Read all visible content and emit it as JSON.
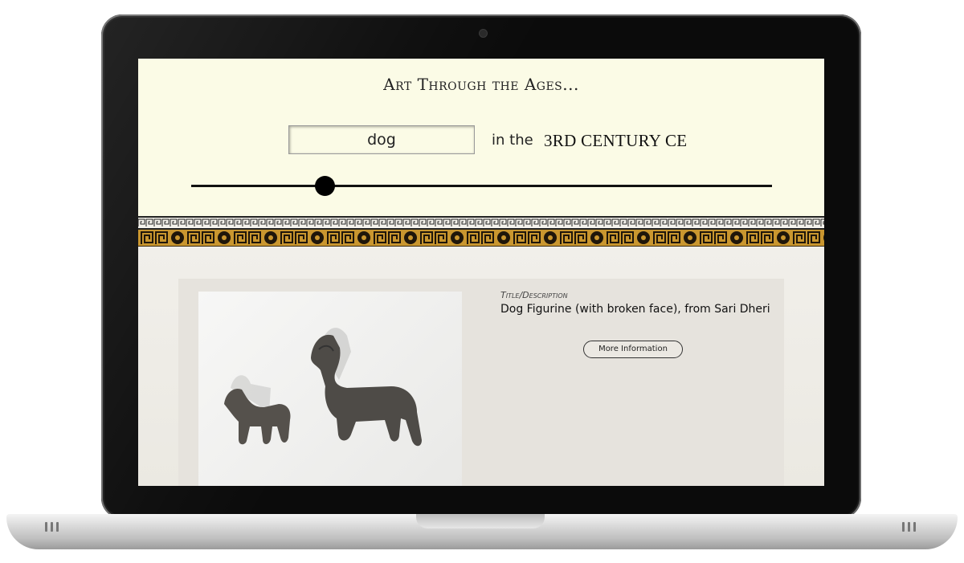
{
  "header": {
    "title": "Art Through the Ages..."
  },
  "search": {
    "value": "dog",
    "connector": "in the",
    "era": "3RD CENTURY CE"
  },
  "timeline": {
    "position_fraction": 0.23
  },
  "result": {
    "description_label": "Title/Description",
    "title": "Dog Figurine (with broken face), from Sari Dheri",
    "more_button": "More Information",
    "image_icon": "terracotta-animal-figurines-photo"
  },
  "icons": {
    "scroll_up": "chevron-up-icon",
    "camera": "webcam-icon"
  },
  "colors": {
    "header_bg": "#fbfbe6",
    "band_gold": "#c9962f",
    "content_bg": "#efede7"
  }
}
